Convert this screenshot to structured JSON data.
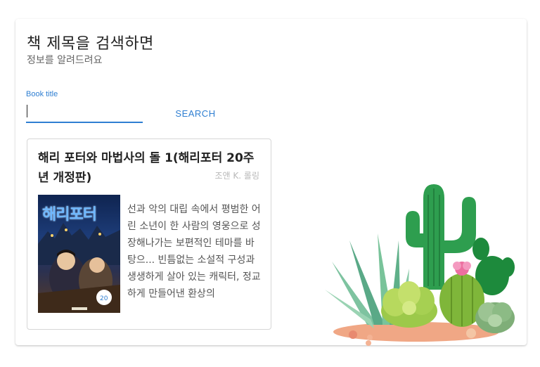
{
  "header": {
    "title": "책 제목을 검색하면",
    "subtitle": "정보를 알려드려요"
  },
  "search": {
    "label": "Book title",
    "value": "",
    "button_label": "SEARCH"
  },
  "result": {
    "title": "해리 포터와 마법사의 돌 1(해리포터 20주년 개정판)",
    "author": "조앤 K. 롤링",
    "cover_text": "해리포터",
    "description": "선과 악의 대립 속에서 평범한 어린 소년이 한 사람의 영웅으로 성장해나가는 보편적인 테마를 바탕으... 빈틈없는 소설적 구성과 생생하게 살아 있는 캐릭터, 정교하게 만들어낸 환상의"
  },
  "colors": {
    "accent": "#2f7fd2",
    "cactus_green": "#2e9e4f"
  },
  "icons": {
    "illustration": "cactus-illustration"
  }
}
